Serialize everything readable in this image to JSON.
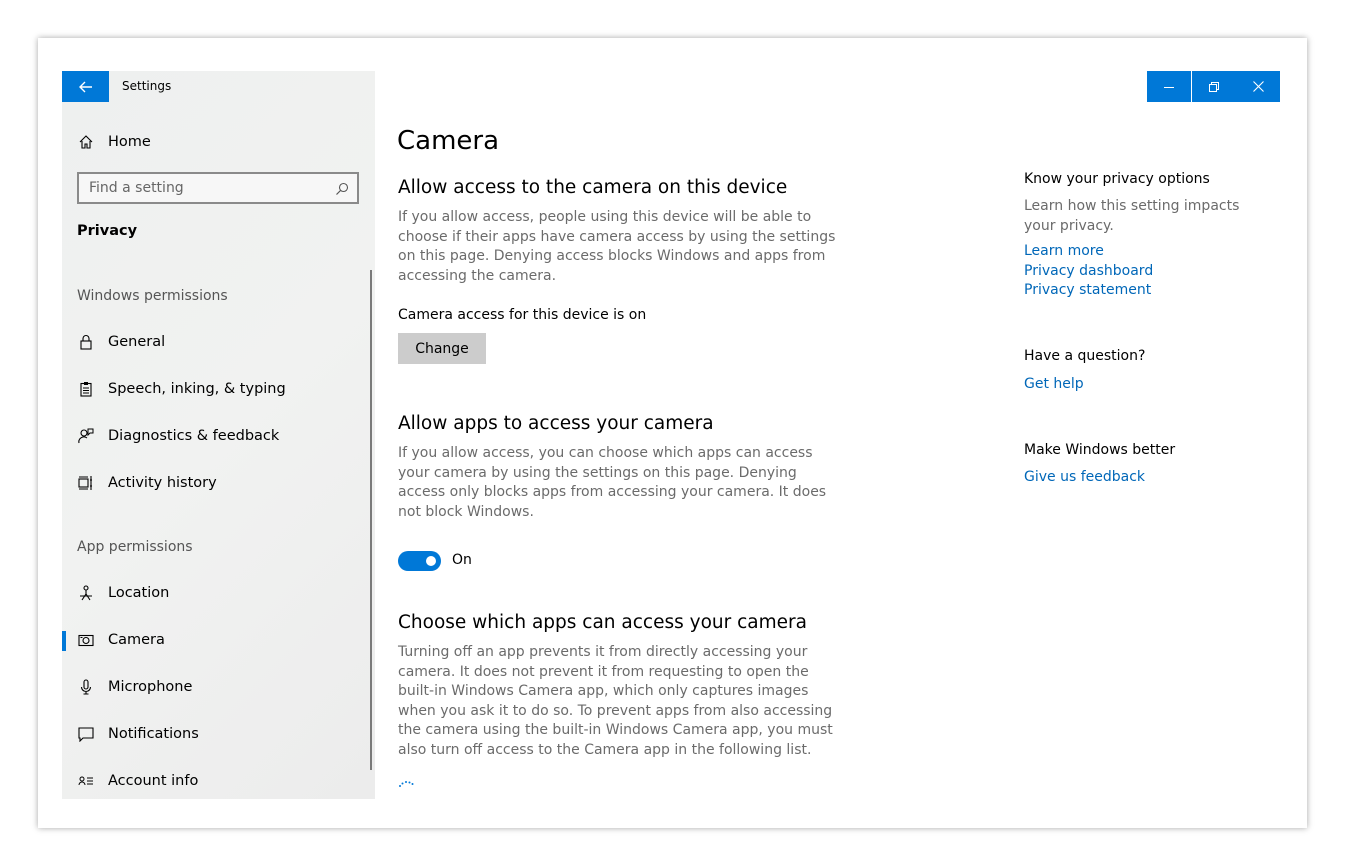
{
  "window": {
    "title": "Settings",
    "controls": [
      "minimize",
      "restore",
      "close"
    ]
  },
  "sidebar": {
    "home_label": "Home",
    "search_placeholder": "Find a setting",
    "category": "Privacy",
    "windows_permissions_label": "Windows permissions",
    "windows_permissions": [
      {
        "label": "General",
        "icon": "lock-icon"
      },
      {
        "label": "Speech, inking, & typing",
        "icon": "clipboard-icon"
      },
      {
        "label": "Diagnostics & feedback",
        "icon": "person-feedback-icon"
      },
      {
        "label": "Activity history",
        "icon": "timeline-icon"
      }
    ],
    "app_permissions_label": "App permissions",
    "app_permissions": [
      {
        "label": "Location",
        "icon": "location-icon"
      },
      {
        "label": "Camera",
        "icon": "camera-icon",
        "selected": true
      },
      {
        "label": "Microphone",
        "icon": "microphone-icon"
      },
      {
        "label": "Notifications",
        "icon": "notification-icon"
      },
      {
        "label": "Account info",
        "icon": "account-info-icon"
      }
    ]
  },
  "main": {
    "title": "Camera",
    "section1": {
      "heading": "Allow access to the camera on this device",
      "description": "If you allow access, people using this device will be able to choose if their apps have camera access by using the settings on this page. Denying access blocks Windows and apps from accessing the camera.",
      "status": "Camera access for this device is on",
      "button": "Change"
    },
    "section2": {
      "heading": "Allow apps to access your camera",
      "description": "If you allow access, you can choose which apps can access your camera by using the settings on this page. Denying access only blocks apps from accessing your camera. It does not block Windows.",
      "toggle_label": "On",
      "toggle_on": true
    },
    "section3": {
      "heading": "Choose which apps can access your camera",
      "description": "Turning off an app prevents it from directly accessing your camera. It does not prevent it from requesting to open the built-in Windows Camera app, which only captures images when you ask it to do so. To prevent apps from also accessing the camera using the built-in Windows Camera app, you must also turn off access to the Camera app in the following list."
    }
  },
  "right_panel": {
    "privacy_heading": "Know your privacy options",
    "privacy_text": "Learn how this setting impacts your privacy.",
    "links": [
      "Learn more",
      "Privacy dashboard",
      "Privacy statement"
    ],
    "question_heading": "Have a question?",
    "help_link": "Get help",
    "better_heading": "Make Windows better",
    "feedback_link": "Give us feedback"
  },
  "colors": {
    "accent": "#0078d7",
    "link": "#0067b8"
  }
}
